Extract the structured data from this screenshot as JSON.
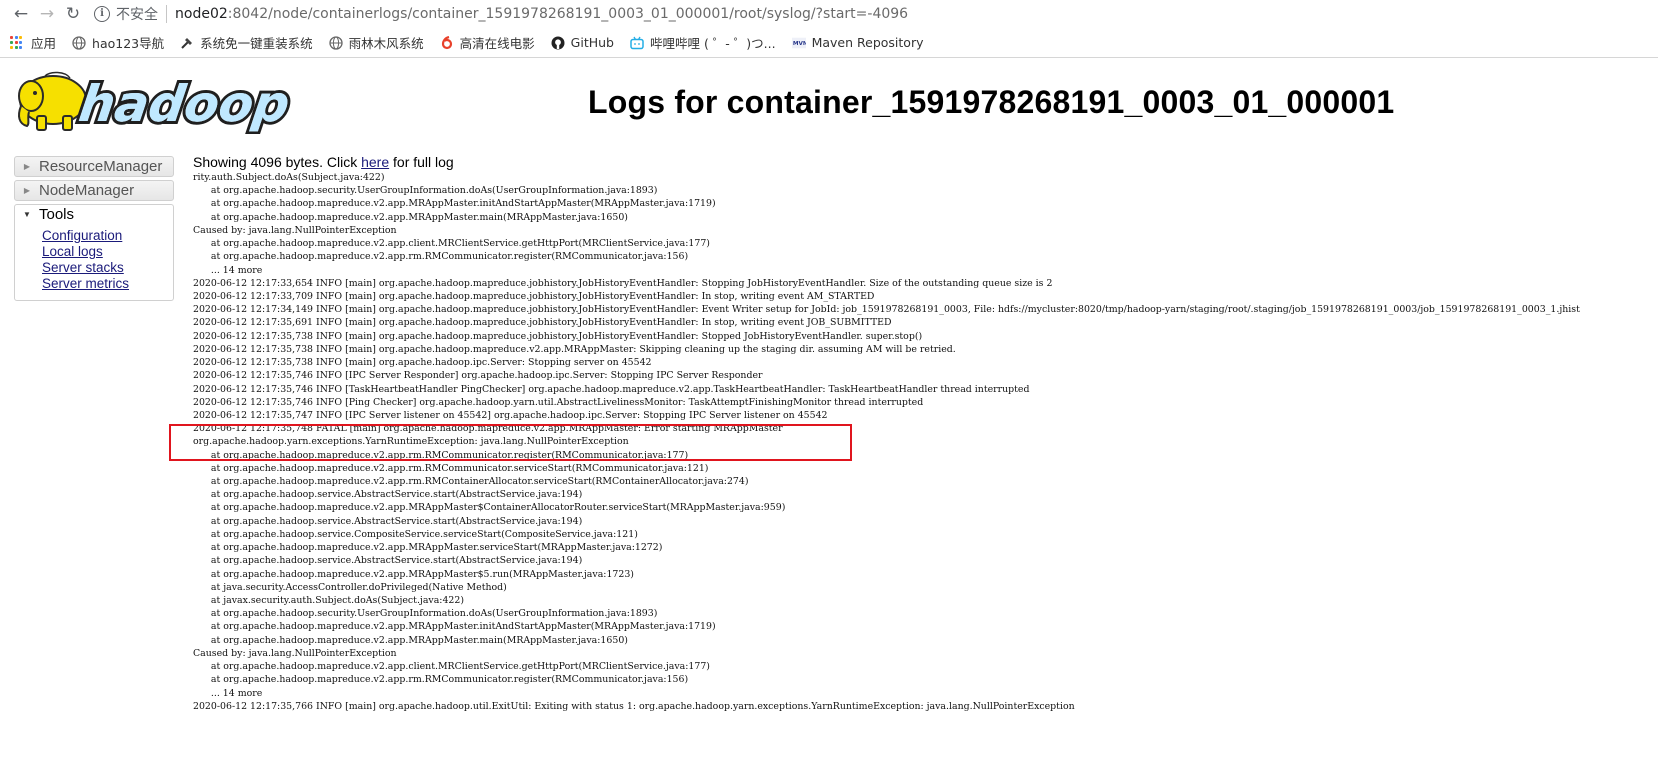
{
  "browser": {
    "security_label": "不安全",
    "url_host": "node02",
    "url_path": ":8042/node/containerlogs/container_1591978268191_0003_01_000001/root/syslog/?start=-4096",
    "bookmarks": [
      {
        "label": "应用",
        "icon": "apps-grid-icon"
      },
      {
        "label": "hao123导航",
        "icon": "globe-icon"
      },
      {
        "label": "系统免一键重装系统",
        "icon": "tools-icon"
      },
      {
        "label": "雨林木风系统",
        "icon": "globe-icon"
      },
      {
        "label": "高清在线电影",
        "icon": "movie-icon",
        "color": "#e8412b"
      },
      {
        "label": "GitHub",
        "icon": "github-icon"
      },
      {
        "label": "哔哩哔哩 ( ゜- ゜)つ...",
        "icon": "bilibili-icon",
        "color": "#23ade5"
      },
      {
        "label": "Maven Repository",
        "icon": "maven-icon"
      }
    ]
  },
  "page": {
    "logo_text": "hadoop",
    "title": "Logs for container_1591978268191_0003_01_000001",
    "sidebar": {
      "resource_manager": "ResourceManager",
      "node_manager": "NodeManager",
      "tools": "Tools",
      "tool_links": [
        "Configuration",
        "Local logs",
        "Server stacks",
        "Server metrics"
      ]
    },
    "showing_prefix": "Showing 4096 bytes. Click ",
    "showing_link": "here",
    "showing_suffix": " for full log",
    "log_lines": [
      "rity.auth.Subject.doAs(Subject.java:422)",
      "\tat org.apache.hadoop.security.UserGroupInformation.doAs(UserGroupInformation.java:1893)",
      "\tat org.apache.hadoop.mapreduce.v2.app.MRAppMaster.initAndStartAppMaster(MRAppMaster.java:1719)",
      "\tat org.apache.hadoop.mapreduce.v2.app.MRAppMaster.main(MRAppMaster.java:1650)",
      "Caused by: java.lang.NullPointerException",
      "\tat org.apache.hadoop.mapreduce.v2.app.client.MRClientService.getHttpPort(MRClientService.java:177)",
      "\tat org.apache.hadoop.mapreduce.v2.app.rm.RMCommunicator.register(RMCommunicator.java:156)",
      "\t... 14 more",
      "2020-06-12 12:17:33,654 INFO [main] org.apache.hadoop.mapreduce.jobhistory.JobHistoryEventHandler: Stopping JobHistoryEventHandler. Size of the outstanding queue size is 2",
      "2020-06-12 12:17:33,709 INFO [main] org.apache.hadoop.mapreduce.jobhistory.JobHistoryEventHandler: In stop, writing event AM_STARTED",
      "2020-06-12 12:17:34,149 INFO [main] org.apache.hadoop.mapreduce.jobhistory.JobHistoryEventHandler: Event Writer setup for JobId: job_1591978268191_0003, File: hdfs://mycluster:8020/tmp/hadoop-yarn/staging/root/.staging/job_1591978268191_0003/job_1591978268191_0003_1.jhist",
      "2020-06-12 12:17:35,691 INFO [main] org.apache.hadoop.mapreduce.jobhistory.JobHistoryEventHandler: In stop, writing event JOB_SUBMITTED",
      "2020-06-12 12:17:35,738 INFO [main] org.apache.hadoop.mapreduce.jobhistory.JobHistoryEventHandler: Stopped JobHistoryEventHandler. super.stop()",
      "2020-06-12 12:17:35,738 INFO [main] org.apache.hadoop.mapreduce.v2.app.MRAppMaster: Skipping cleaning up the staging dir. assuming AM will be retried.",
      "2020-06-12 12:17:35,738 INFO [main] org.apache.hadoop.ipc.Server: Stopping server on 45542",
      "2020-06-12 12:17:35,746 INFO [IPC Server Responder] org.apache.hadoop.ipc.Server: Stopping IPC Server Responder",
      "2020-06-12 12:17:35,746 INFO [TaskHeartbeatHandler PingChecker] org.apache.hadoop.mapreduce.v2.app.TaskHeartbeatHandler: TaskHeartbeatHandler thread interrupted",
      "2020-06-12 12:17:35,746 INFO [Ping Checker] org.apache.hadoop.yarn.util.AbstractLivelinessMonitor: TaskAttemptFinishingMonitor thread interrupted",
      "2020-06-12 12:17:35,747 INFO [IPC Server listener on 45542] org.apache.hadoop.ipc.Server: Stopping IPC Server listener on 45542",
      "2020-06-12 12:17:35,748 FATAL [main] org.apache.hadoop.mapreduce.v2.app.MRAppMaster: Error starting MRAppMaster",
      "org.apache.hadoop.yarn.exceptions.YarnRuntimeException: java.lang.NullPointerException",
      "\tat org.apache.hadoop.mapreduce.v2.app.rm.RMCommunicator.register(RMCommunicator.java:177)",
      "\tat org.apache.hadoop.mapreduce.v2.app.rm.RMCommunicator.serviceStart(RMCommunicator.java:121)",
      "\tat org.apache.hadoop.mapreduce.v2.app.rm.RMContainerAllocator.serviceStart(RMContainerAllocator.java:274)",
      "\tat org.apache.hadoop.service.AbstractService.start(AbstractService.java:194)",
      "\tat org.apache.hadoop.mapreduce.v2.app.MRAppMaster$ContainerAllocatorRouter.serviceStart(MRAppMaster.java:959)",
      "\tat org.apache.hadoop.service.AbstractService.start(AbstractService.java:194)",
      "\tat org.apache.hadoop.service.CompositeService.serviceStart(CompositeService.java:121)",
      "\tat org.apache.hadoop.mapreduce.v2.app.MRAppMaster.serviceStart(MRAppMaster.java:1272)",
      "\tat org.apache.hadoop.service.AbstractService.start(AbstractService.java:194)",
      "\tat org.apache.hadoop.mapreduce.v2.app.MRAppMaster$5.run(MRAppMaster.java:1723)",
      "\tat java.security.AccessController.doPrivileged(Native Method)",
      "\tat javax.security.auth.Subject.doAs(Subject.java:422)",
      "\tat org.apache.hadoop.security.UserGroupInformation.doAs(UserGroupInformation.java:1893)",
      "\tat org.apache.hadoop.mapreduce.v2.app.MRAppMaster.initAndStartAppMaster(MRAppMaster.java:1719)",
      "\tat org.apache.hadoop.mapreduce.v2.app.MRAppMaster.main(MRAppMaster.java:1650)",
      "Caused by: java.lang.NullPointerException",
      "\tat org.apache.hadoop.mapreduce.v2.app.client.MRClientService.getHttpPort(MRClientService.java:177)",
      "\tat org.apache.hadoop.mapreduce.v2.app.rm.RMCommunicator.register(RMCommunicator.java:156)",
      "\t... 14 more",
      "2020-06-12 12:17:35,766 INFO [main] org.apache.hadoop.util.ExitUtil: Exiting with status 1: org.apache.hadoop.yarn.exceptions.YarnRuntimeException: java.lang.NullPointerException"
    ],
    "highlight_color": "#e0151e",
    "link_color": "#1a1a7a"
  }
}
